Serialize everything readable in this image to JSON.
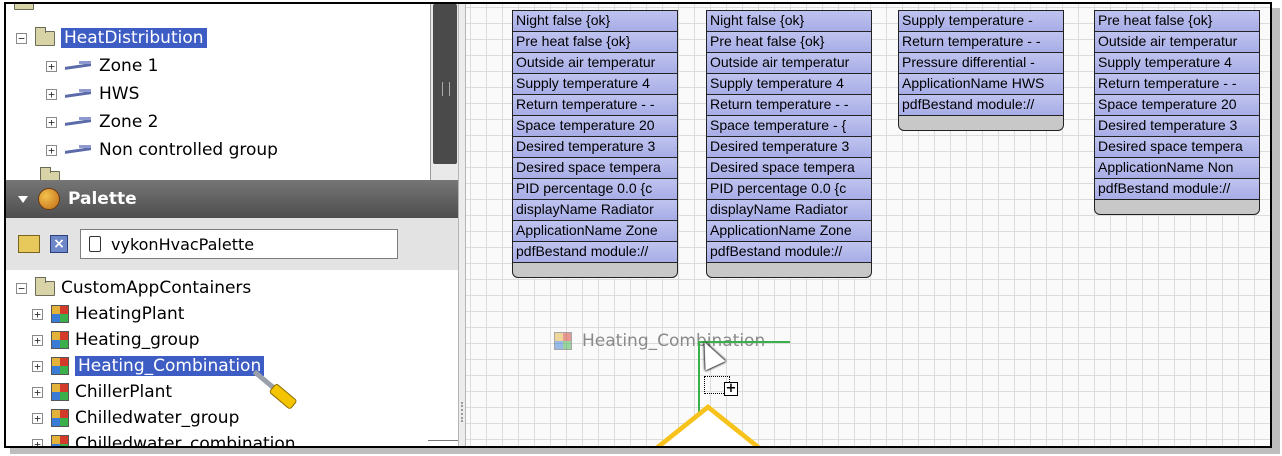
{
  "nav_tree": {
    "items": [
      {
        "label": "HeatDistribution",
        "expander": "−",
        "icon": "folder-icon"
      },
      {
        "label": "Zone 1",
        "expander": "+",
        "icon": "wire-icon"
      },
      {
        "label": "HWS",
        "expander": "+",
        "icon": "wire-icon"
      },
      {
        "label": "Zone 2",
        "expander": "+",
        "icon": "wire-icon"
      },
      {
        "label": "Non controlled group",
        "expander": "+",
        "icon": "wire-icon"
      }
    ]
  },
  "palette": {
    "title": "Palette",
    "field_value": "vykonHvacPalette",
    "root_label": "CustomAppContainers",
    "root_expander": "−",
    "items": [
      {
        "label": "HeatingPlant",
        "expander": "+"
      },
      {
        "label": "Heating_group",
        "expander": "+"
      },
      {
        "label": "Heating_Combination",
        "expander": "+"
      },
      {
        "label": "ChillerPlant",
        "expander": "+"
      },
      {
        "label": "Chilledwater_group",
        "expander": "+"
      },
      {
        "label": "Chilledwater_combination",
        "expander": "+"
      }
    ]
  },
  "canvas": {
    "blocks": [
      {
        "slots": [
          "Night      false {ok}",
          "Pre heat    false {ok}",
          "Outside air temperatur",
          "Supply temperature  4",
          "Return temperature  - -",
          "Space temperature  20",
          "Desired temperature  3",
          "Desired space tempera",
          "PID percentage  0.0 {c",
          "displayName  Radiator",
          "ApplicationName  Zone",
          "pdfBestand  module://"
        ]
      },
      {
        "slots": [
          "Night      false {ok}",
          "Pre heat    false {ok}",
          "Outside air temperatur",
          "Supply temperature  4",
          "Return temperature  - -",
          "Space temperature  - {",
          "Desired temperature  3",
          "Desired space tempera",
          "PID percentage  0.0 {c",
          "displayName  Radiator",
          "ApplicationName  Zone",
          "pdfBestand  module://"
        ]
      },
      {
        "slots": [
          "Supply temperature  -",
          "Return temperature  - -",
          "Pressure differential  -",
          "ApplicationName  HWS",
          "pdfBestand  module://"
        ]
      },
      {
        "slots": [
          "Pre heat    false {ok}",
          "Outside air temperatur",
          "Supply temperature  4",
          "Return temperature  - -",
          "Space temperature  20",
          "Desired temperature  3",
          "Desired space tempera",
          "ApplicationName  Non",
          "pdfBestand  module://"
        ]
      }
    ],
    "drag_ghost_label": "Heating_Combination",
    "drop_plus": "+"
  },
  "colors": {
    "selection": "#3d5dc4",
    "slot_fill": "#b4b9ea",
    "wire_green": "#3bb04a",
    "callout": "#f7c21b"
  }
}
